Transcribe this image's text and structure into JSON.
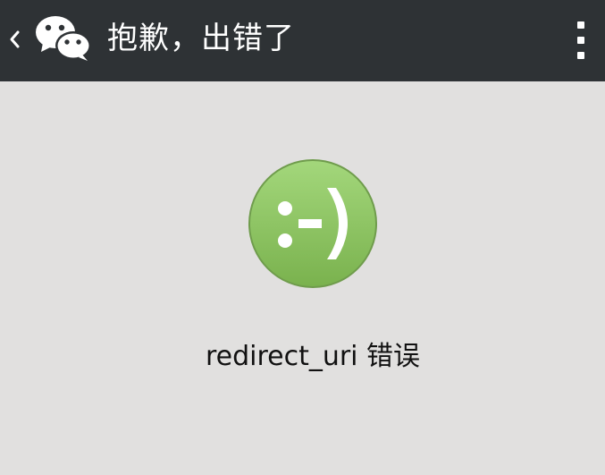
{
  "header": {
    "title": "抱歉，出错了",
    "back_icon": "chevron-left",
    "logo_icon": "wechat-logo",
    "menu_icon": "more-vertical"
  },
  "main": {
    "status_icon": "error-smiley",
    "status_icon_text": ":-)",
    "message": "redirect_uri 错误"
  },
  "colors": {
    "header_bg": "#2e3235",
    "page_bg": "#e1e0df",
    "icon_green": "#8cc362",
    "text": "#111111"
  }
}
